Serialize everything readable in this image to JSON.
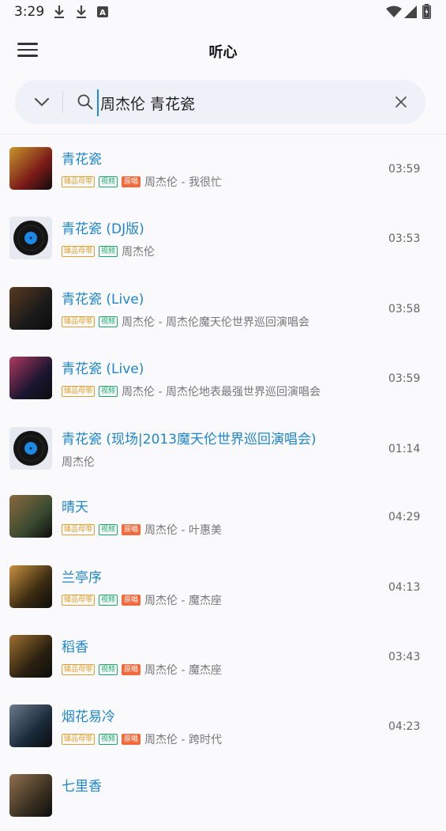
{
  "status_bar": {
    "time": "3:29",
    "icons": [
      "download-icon",
      "download-icon",
      "font-a-icon",
      "wifi-icon",
      "signal-icon",
      "battery-charging-icon"
    ]
  },
  "app_bar": {
    "title": "听心",
    "menu_icon": "hamburger-menu-icon"
  },
  "search": {
    "dropdown_icon": "chevron-down-icon",
    "search_icon": "search-icon",
    "value": "周杰伦 青花瓷",
    "clear_icon": "close-icon"
  },
  "badge_labels": {
    "quality": "臻品母带",
    "video": "视频",
    "original": "原唱"
  },
  "songs": [
    {
      "title": "青花瓷",
      "subtitle": "周杰伦 - 我很忙",
      "duration": "03:59",
      "badges": [
        "quality",
        "video",
        "original"
      ],
      "cover": "album"
    },
    {
      "title": "青花瓷 (DJ版)",
      "subtitle": "周杰伦",
      "duration": "03:53",
      "badges": [
        "quality",
        "video"
      ],
      "cover": "vinyl"
    },
    {
      "title": "青花瓷 (Live)",
      "subtitle": "周杰伦 - 周杰伦魔天伦世界巡回演唱会",
      "duration": "03:58",
      "badges": [
        "quality",
        "video"
      ],
      "cover": "album"
    },
    {
      "title": "青花瓷 (Live)",
      "subtitle": "周杰伦 - 周杰伦地表最强世界巡回演唱会",
      "duration": "03:59",
      "badges": [
        "quality",
        "video"
      ],
      "cover": "album"
    },
    {
      "title": "青花瓷 (现场|2013魔天伦世界巡回演唱会)",
      "subtitle": "周杰伦",
      "duration": "01:14",
      "badges": [],
      "cover": "vinyl"
    },
    {
      "title": "晴天",
      "subtitle": "周杰伦 - 叶惠美",
      "duration": "04:29",
      "badges": [
        "quality",
        "video",
        "original"
      ],
      "cover": "album"
    },
    {
      "title": "兰亭序",
      "subtitle": "周杰伦 - 魔杰座",
      "duration": "04:13",
      "badges": [
        "quality",
        "video",
        "original"
      ],
      "cover": "album"
    },
    {
      "title": "稻香",
      "subtitle": "周杰伦 - 魔杰座",
      "duration": "03:43",
      "badges": [
        "quality",
        "video",
        "original"
      ],
      "cover": "album"
    },
    {
      "title": "烟花易冷",
      "subtitle": "周杰伦 - 跨时代",
      "duration": "04:23",
      "badges": [
        "quality",
        "video",
        "original"
      ],
      "cover": "album"
    },
    {
      "title": "七里香",
      "subtitle": "",
      "duration": "",
      "badges": [],
      "cover": "album"
    }
  ],
  "colors": {
    "title_blue": "#1f86c9",
    "badge_quality": "#e0a030",
    "badge_video": "#1aa86a",
    "badge_original": "#f06a3c"
  }
}
